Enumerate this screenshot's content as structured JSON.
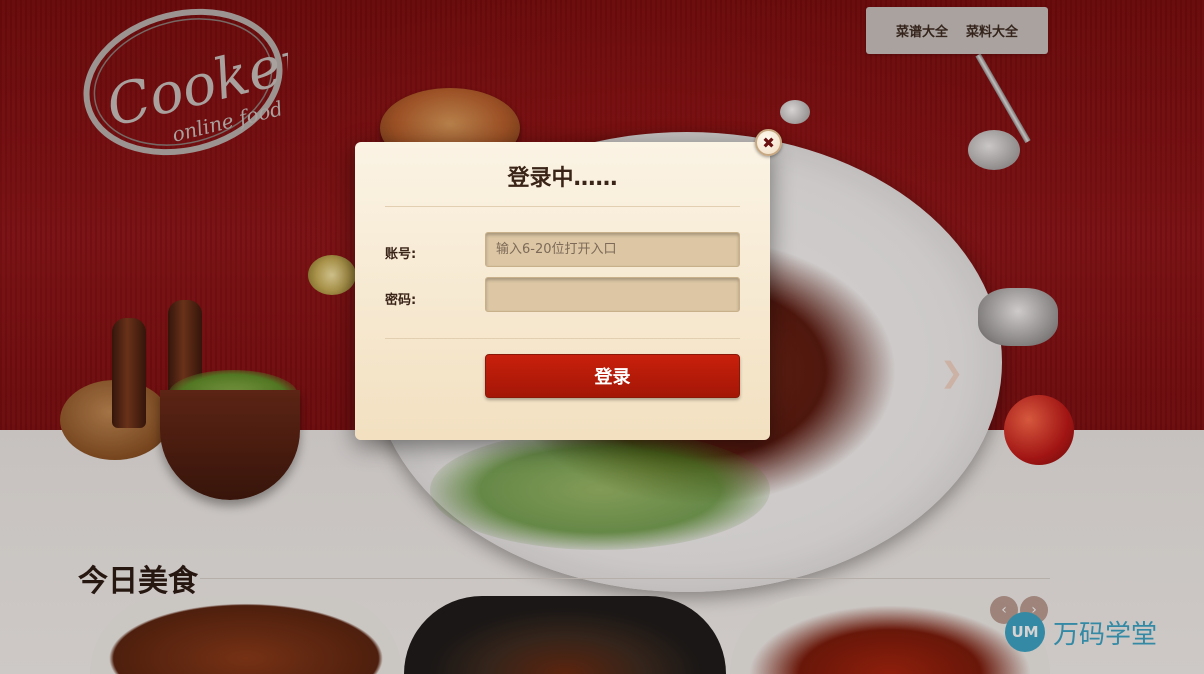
{
  "logo": {
    "brand": "Cooker",
    "tagline": "online food"
  },
  "topnav": {
    "items": [
      {
        "label": "菜谱大全"
      },
      {
        "label": "菜料大全"
      }
    ]
  },
  "slider": {
    "next_icon": "chevron-right-icon",
    "next_glyph": "❯"
  },
  "section": {
    "title": "今日美食"
  },
  "carousel": {
    "prev_glyph": "‹",
    "next_glyph": "›"
  },
  "watermark": {
    "badge": "UM",
    "text": "万码学堂"
  },
  "login_modal": {
    "title": "登录中……",
    "account_label": "账号:",
    "account_placeholder": "输入6-20位打开入口",
    "account_value": "",
    "password_label": "密码:",
    "password_value": "",
    "submit_label": "登录",
    "close_icon": "close-icon",
    "close_glyph": "✖"
  },
  "colors": {
    "hero_red": "#8e1216",
    "modal_bg": "#f6e8cf",
    "input_bg": "#dcc6a4",
    "button_red": "#b81a08",
    "watermark_blue": "#3aa7c9"
  }
}
